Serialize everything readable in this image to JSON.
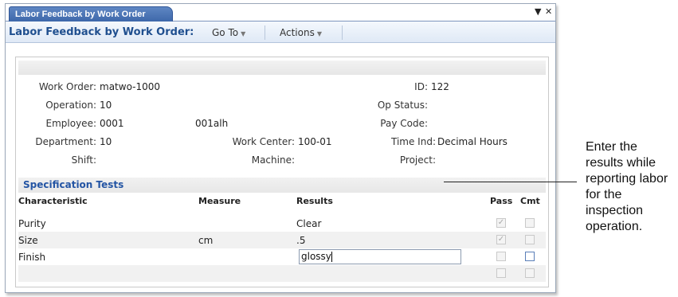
{
  "tab": {
    "label": "Labor Feedback by Work Order"
  },
  "window_controls": {
    "dropdown_glyph": "▼",
    "close_glyph": "✕"
  },
  "menubar": {
    "title": "Labor Feedback by Work Order:",
    "goto_label": "Go To",
    "actions_label": "Actions"
  },
  "form": {
    "work_order": {
      "label": "Work Order:",
      "value": "matwo-1000"
    },
    "id": {
      "label": "ID:",
      "value": "122"
    },
    "operation": {
      "label": "Operation:",
      "value": "10"
    },
    "op_status": {
      "label": "Op Status:",
      "value": ""
    },
    "employee": {
      "label": "Employee:",
      "value": "0001",
      "name": "001alh"
    },
    "pay_code": {
      "label": "Pay Code:",
      "value": ""
    },
    "department": {
      "label": "Department:",
      "value": "10"
    },
    "work_center": {
      "label": "Work Center:",
      "value": "100-01"
    },
    "time_ind": {
      "label": "Time Ind:",
      "value": "Decimal Hours"
    },
    "shift": {
      "label": "Shift:",
      "value": ""
    },
    "machine": {
      "label": "Machine:",
      "value": ""
    },
    "project": {
      "label": "Project:",
      "value": ""
    }
  },
  "spec_tests": {
    "title": "Specification Tests",
    "columns": {
      "characteristic": "Characteristic",
      "measure": "Measure",
      "results": "Results",
      "pass": "Pass",
      "cmt": "Cmt"
    },
    "rows": [
      {
        "characteristic": "Purity",
        "measure": "",
        "results": "Clear",
        "pass": true,
        "cmt": false,
        "editable": false
      },
      {
        "characteristic": "Size",
        "measure": "cm",
        "results": ".5",
        "pass": true,
        "cmt": false,
        "editable": false
      },
      {
        "characteristic": "Finish",
        "measure": "",
        "results": "glossy",
        "pass": false,
        "cmt": false,
        "editable": true
      },
      {
        "characteristic": "",
        "measure": "",
        "results": "",
        "pass": false,
        "cmt": false,
        "editable": false
      }
    ]
  },
  "callout": {
    "text": "Enter the results while reporting labor for the inspection operation."
  },
  "colors": {
    "tab": "#4a74b6",
    "section_title": "#2455a4",
    "menubar_title": "#1f4f8f"
  }
}
